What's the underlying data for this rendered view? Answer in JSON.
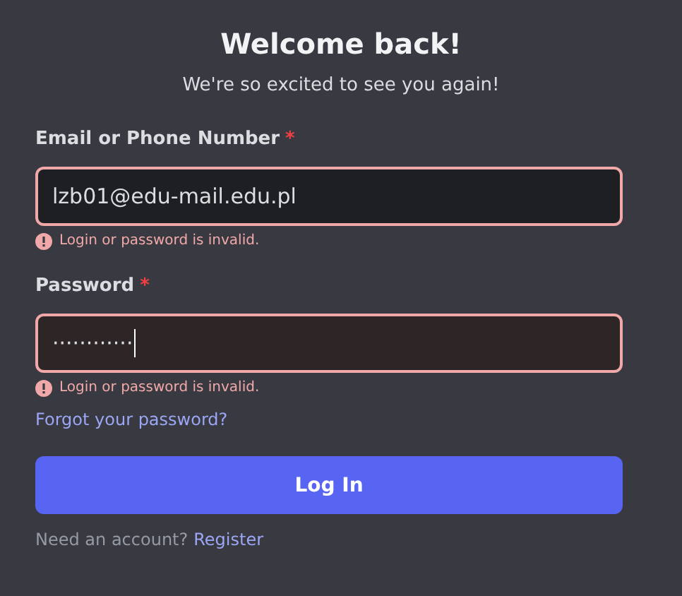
{
  "title": "Welcome back!",
  "subtitle": "We're so excited to see you again!",
  "fields": [
    {
      "label": "Email or Phone Number",
      "required_mark": "*",
      "value": "lzb01@edu-mail.edu.pl",
      "invalid": true,
      "focused": false,
      "error": "Login or password is invalid."
    },
    {
      "label": "Password",
      "required_mark": "*",
      "value": "············",
      "invalid": true,
      "focused": true,
      "error": "Login or password is invalid."
    }
  ],
  "forgot_link": "Forgot your password?",
  "login_button": "Log In",
  "register_prompt": "Need an account?",
  "register_link": "Register"
}
